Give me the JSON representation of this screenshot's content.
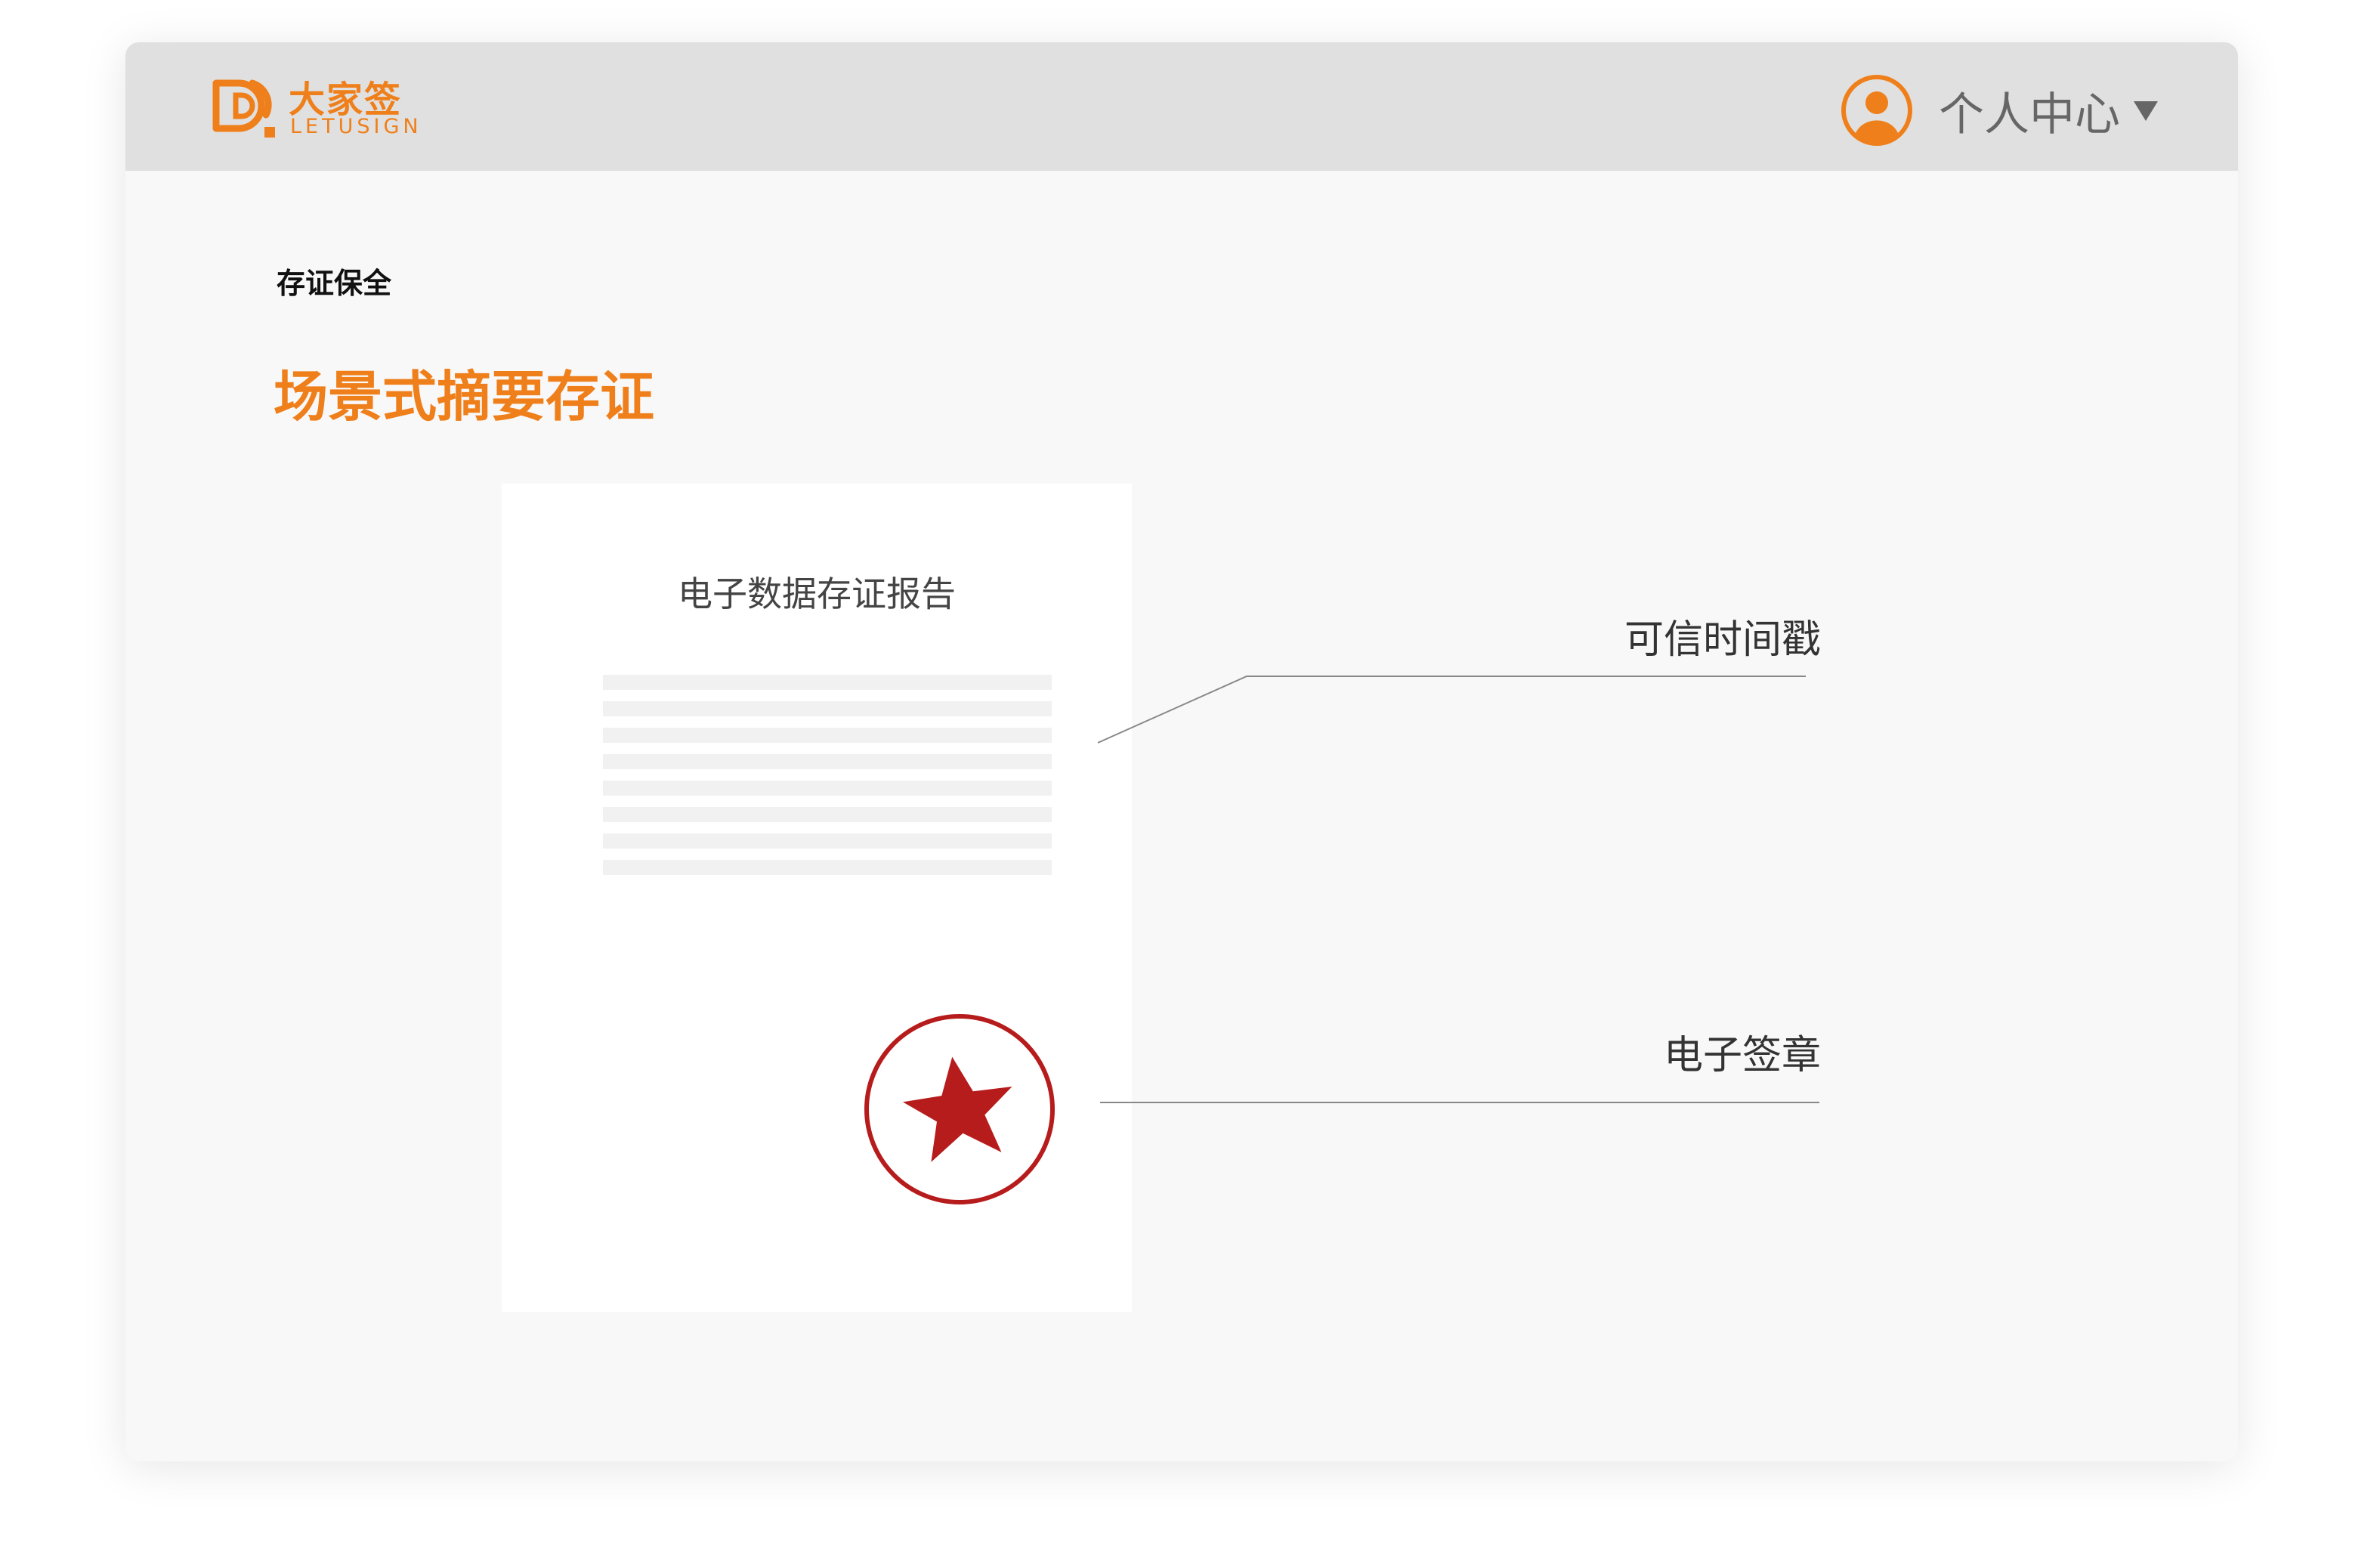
{
  "header": {
    "logo": {
      "brand_cn": "大家签",
      "brand_en": "LETUSIGN",
      "icon": "letusign-logo-icon"
    },
    "user_menu": {
      "label": "个人中心",
      "avatar_icon": "user-avatar-icon",
      "caret_icon": "caret-down-icon"
    }
  },
  "main": {
    "section_label": "存证保全",
    "title": "场景式摘要存证",
    "document": {
      "title": "电子数据存证报告",
      "seal_icon": "red-star-seal-icon"
    },
    "callouts": {
      "timestamp": "可信时间戳",
      "seal": "电子签章"
    }
  },
  "colors": {
    "brand": "#ef7f1a",
    "seal": "#b71c1c",
    "header_bg": "#e0e0e0",
    "page_bg": "#f8f8f9"
  }
}
